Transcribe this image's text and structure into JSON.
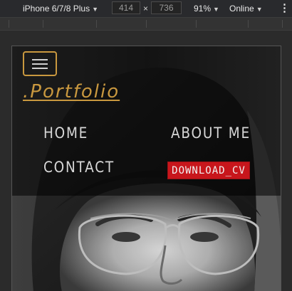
{
  "devtools": {
    "device": "iPhone 6/7/8 Plus",
    "width": "414",
    "times": "×",
    "height": "736",
    "zoom": "91%",
    "network": "Online",
    "caret": "▼",
    "more": "⋮"
  },
  "site": {
    "logo": ".Portfolio",
    "nav": {
      "home": "HOME",
      "about": "ABOUT ME",
      "contact": "CONTACT",
      "download_cv": "DOWNLOAD_CV"
    },
    "colors": {
      "accent": "#c9983f",
      "cv_button": "#c8161c"
    }
  }
}
